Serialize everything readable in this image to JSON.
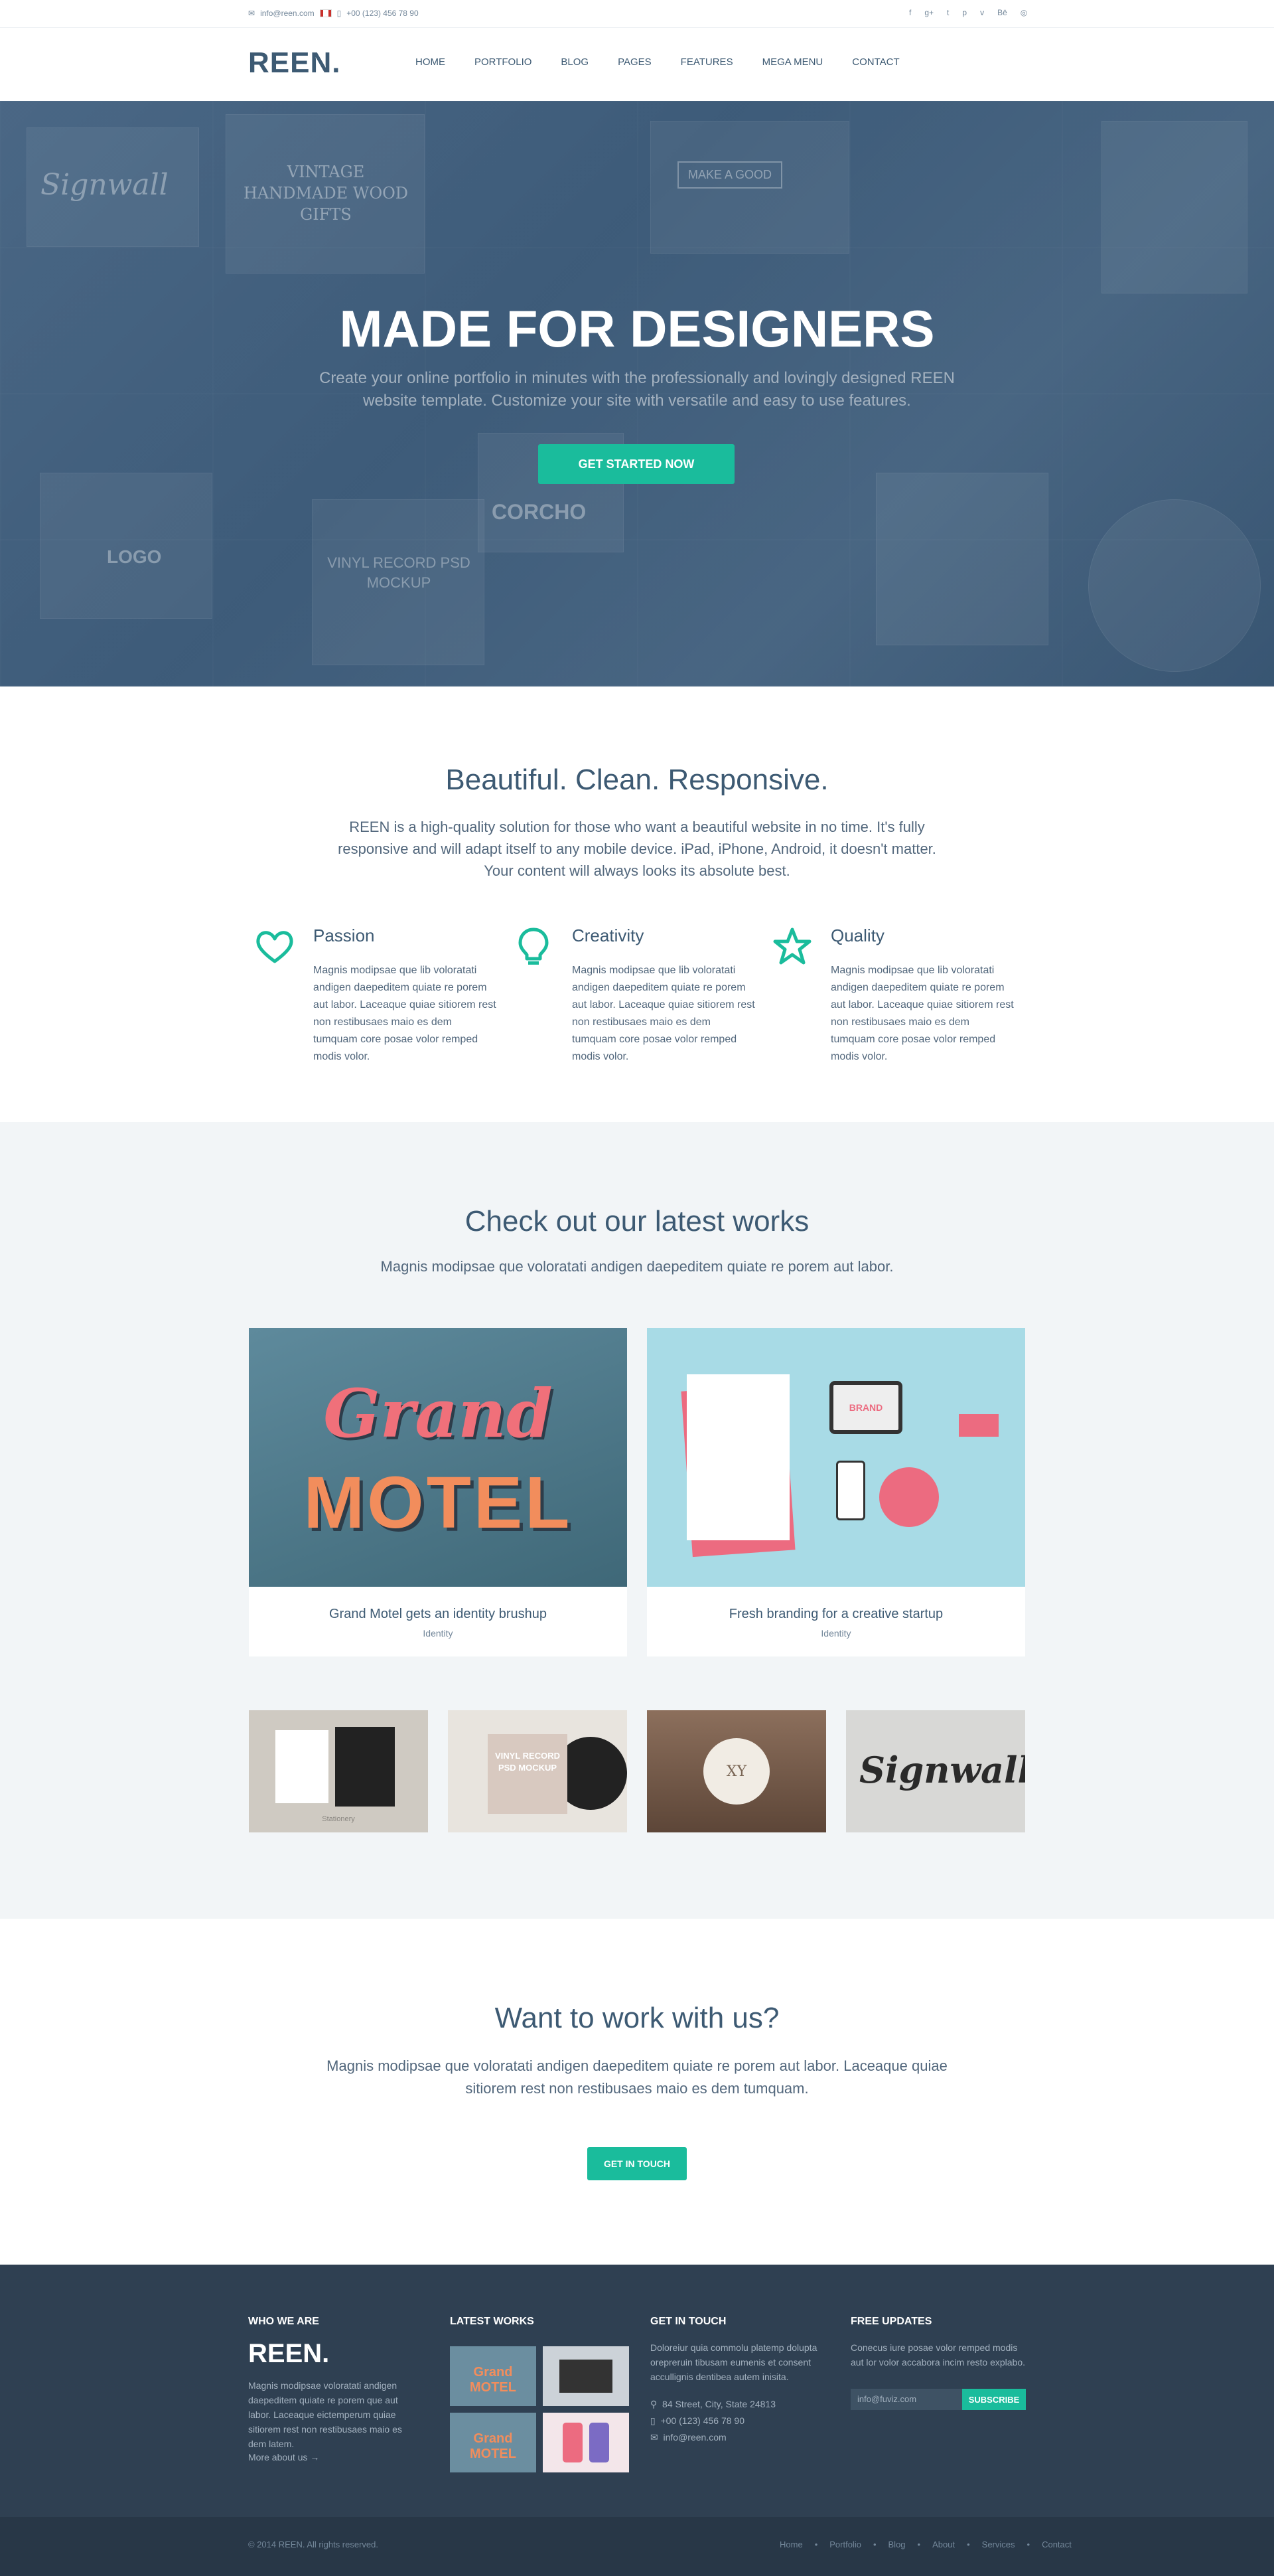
{
  "topbar": {
    "email": "info@reen.com",
    "phone": "+00 (123) 456 78 90",
    "social_icons": [
      "facebook-icon",
      "google-plus-icon",
      "twitter-icon",
      "pinterest-icon",
      "vimeo-icon",
      "behance-icon",
      "dribbble-icon"
    ]
  },
  "header": {
    "logo": "REEN.",
    "nav": [
      "HOME",
      "PORTFOLIO",
      "BLOG",
      "PAGES",
      "FEATURES",
      "MEGA MENU",
      "CONTACT"
    ]
  },
  "hero": {
    "title": "MADE FOR DESIGNERS",
    "subtitle": "Create your online portfolio in minutes with the professionally and lovingly designed REEN website template. Customize your site with versatile and easy to use features.",
    "button": "GET STARTED NOW",
    "tiles": [
      "Signwall",
      "VINTAGE HANDMADE WOOD GIFTS",
      "MAKE A GOOD",
      "VINYL RECORD PSD MOCKUP",
      "CORCHO",
      "LOGO"
    ]
  },
  "about": {
    "title": "Beautiful. Clean. Responsive.",
    "body": "REEN is a high-quality solution for those who want a beautiful website in no time. It's fully responsive and will adapt itself to any mobile device. iPad, iPhone, Android, it doesn't matter. Your content will always looks its absolute best.",
    "features": [
      {
        "icon": "heart-icon",
        "title": "Passion",
        "text": "Magnis modipsae que lib voloratati andigen daepeditem quiate re porem aut labor. Laceaque quiae sitiorem rest non restibusaes maio es dem tumquam core posae volor remped modis volor."
      },
      {
        "icon": "lightbulb-icon",
        "title": "Creativity",
        "text": "Magnis modipsae que lib voloratati andigen daepeditem quiate re porem aut labor. Laceaque quiae sitiorem rest non restibusaes maio es dem tumquam core posae volor remped modis volor."
      },
      {
        "icon": "star-icon",
        "title": "Quality",
        "text": "Magnis modipsae que lib voloratati andigen daepeditem quiate re porem aut labor. Laceaque quiae sitiorem rest non restibusaes maio es dem tumquam core posae volor remped modis volor."
      }
    ]
  },
  "works": {
    "title": "Check out our latest works",
    "subtitle": "Magnis modipsae que voloratati andigen daepeditem quiate re porem aut labor.",
    "featured": [
      {
        "caption": "Grand Motel gets an identity brushup",
        "tag": "Identity",
        "art_line1": "Grand",
        "art_line2": "MOTEL"
      },
      {
        "caption": "Fresh branding for a creative startup",
        "tag": "Identity",
        "art": "BRAND"
      }
    ],
    "thumbs": [
      {
        "art": "Stationery"
      },
      {
        "art": "VINYL RECORD PSD MOCKUP"
      },
      {
        "art": "XY"
      },
      {
        "art": "Signwall"
      }
    ]
  },
  "cta": {
    "title": "Want to work with us?",
    "body": "Magnis modipsae que voloratati andigen daepeditem quiate re porem aut labor. Laceaque quiae sitiorem rest non restibusaes maio es dem tumquam.",
    "button": "GET IN TOUCH"
  },
  "footer": {
    "who": {
      "title": "WHO WE ARE",
      "logo": "REEN.",
      "text": "Magnis modipsae voloratati andigen daepeditem quiate re porem que aut labor. Laceaque eictemperum quiae sitiorem rest non restibusaes maio es dem latem.",
      "more": "More about us →"
    },
    "latest": {
      "title": "LATEST WORKS",
      "thumbs": [
        "Grand MOTEL",
        "laptop",
        "Grand MOTEL",
        "phones"
      ]
    },
    "touch": {
      "title": "GET IN TOUCH",
      "text": "Doloreiur quia commolu platemp dolupta orepreruin tibusam eumenis et consent accullignis dentibea autem inisita.",
      "address": "84 Street, City, State 24813",
      "phone": "+00 (123) 456 78 90",
      "email": "info@reen.com"
    },
    "updates": {
      "title": "FREE UPDATES",
      "text": "Conecus iure posae volor remped modis aut lor volor accabora incim resto explabo.",
      "placeholder": "info@fuviz.com",
      "button": "SUBSCRIBE"
    },
    "copyright": "© 2014 REEN. All rights reserved.",
    "links": [
      "Home",
      "Portfolio",
      "Blog",
      "About",
      "Services",
      "Contact"
    ]
  },
  "colors": {
    "accent": "#1abc9c",
    "primary_text": "#3d5a73",
    "hero_subtitle": "#a3b1bf",
    "footer_bg": "#2f4052",
    "works_bg": "#f2f5f7"
  }
}
